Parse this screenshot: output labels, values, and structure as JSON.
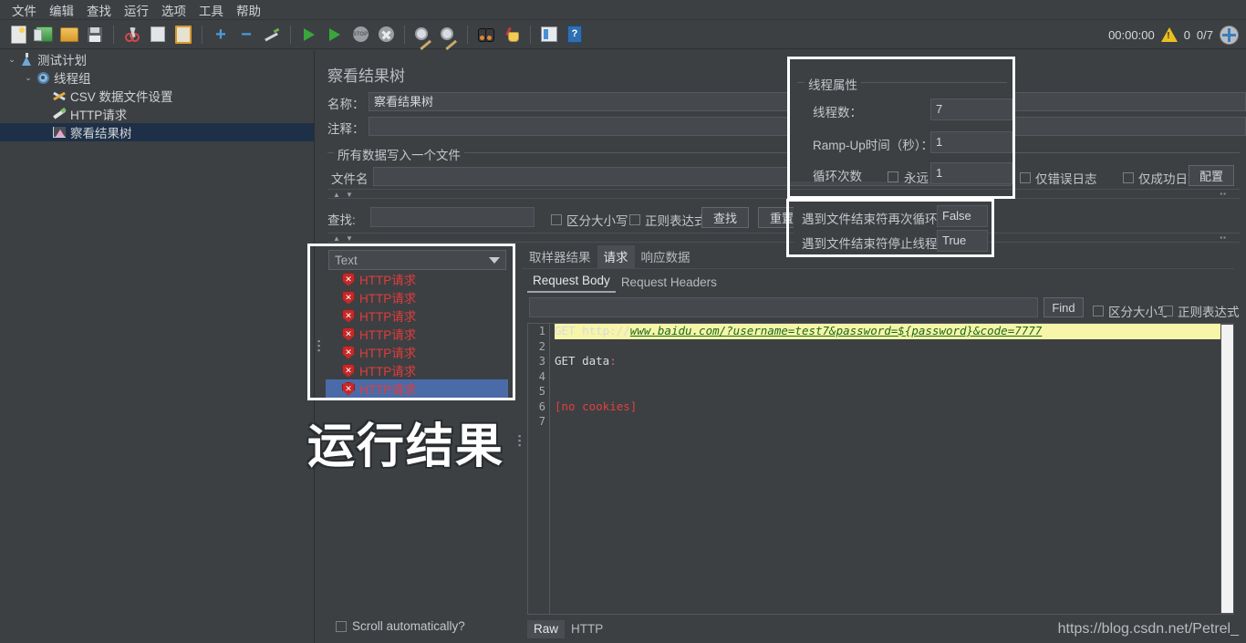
{
  "menu": {
    "items": [
      "文件",
      "编辑",
      "查找",
      "运行",
      "选项",
      "工具",
      "帮助"
    ]
  },
  "toolbar": {
    "icons": [
      "new-icon",
      "template-icon",
      "open-icon",
      "save-icon",
      "cut-icon",
      "copy-icon",
      "paste-icon",
      "expand-icon",
      "collapse-icon",
      "toggle-icon",
      "start-icon",
      "start-no-pause-icon",
      "stop-icon",
      "shutdown-icon",
      "clear-icon",
      "clear-all-icon",
      "search-icon",
      "search-reset-icon",
      "function-helper-icon",
      "help-icon"
    ],
    "status": {
      "clock": "00:00:00",
      "warnings": "0",
      "threads": "0/7"
    }
  },
  "tree": {
    "items": [
      {
        "label": "测试计划",
        "icon": "test-plan-icon",
        "indent": 0,
        "expanded": true,
        "selected": false
      },
      {
        "label": "线程组",
        "icon": "thread-group-icon",
        "indent": 1,
        "expanded": true,
        "selected": false
      },
      {
        "label": "CSV 数据文件设置",
        "icon": "csv-config-icon",
        "indent": 2,
        "expanded": null,
        "selected": false
      },
      {
        "label": "HTTP请求",
        "icon": "http-sampler-icon",
        "indent": 2,
        "expanded": null,
        "selected": false
      },
      {
        "label": "察看结果树",
        "icon": "view-results-tree-icon",
        "indent": 2,
        "expanded": null,
        "selected": true
      }
    ]
  },
  "panel": {
    "title": "察看结果树",
    "name_label": "名称：",
    "name_value": "察看结果树",
    "comment_label": "注释：",
    "comment_value": "",
    "group_title": "所有数据写入一个文件",
    "filename_label": "文件名",
    "filename_value": "",
    "errors_only_label": "仅错误日志",
    "success_only_label": "仅成功日志",
    "configure_button": "配置"
  },
  "search_bar": {
    "label": "查找:",
    "value": "",
    "case_label": "区分大小写",
    "regex_label": "正则表达式",
    "find_button": "查找",
    "reset_button": "重置"
  },
  "results": {
    "render_selected": "Text",
    "entries": [
      {
        "label": "HTTP请求",
        "status": "error",
        "selected": false
      },
      {
        "label": "HTTP请求",
        "status": "error",
        "selected": false
      },
      {
        "label": "HTTP请求",
        "status": "error",
        "selected": false
      },
      {
        "label": "HTTP请求",
        "status": "error",
        "selected": false
      },
      {
        "label": "HTTP请求",
        "status": "error",
        "selected": false
      },
      {
        "label": "HTTP请求",
        "status": "error",
        "selected": false
      },
      {
        "label": "HTTP请求",
        "status": "error",
        "selected": true
      }
    ],
    "scroll_auto_label": "Scroll automatically?"
  },
  "detail": {
    "tabs": [
      {
        "label": "取样器结果",
        "active": false
      },
      {
        "label": "请求",
        "active": true
      },
      {
        "label": "响应数据",
        "active": false
      }
    ],
    "subtabs": [
      {
        "label": "Request Body",
        "active": true
      },
      {
        "label": "Request Headers",
        "active": false
      }
    ],
    "find_value": "",
    "find_button": "Find",
    "case_label": "区分大小写",
    "regex_label": "正则表达式",
    "code_lines": [
      {
        "n": "1",
        "text": "GET http://www.baidu.com/?username=test7&password=${password}&code=7777",
        "style": "highlight"
      },
      {
        "n": "2",
        "text": "",
        "style": "plain"
      },
      {
        "n": "3",
        "text": "GET data:",
        "style": "plain"
      },
      {
        "n": "4",
        "text": "",
        "style": "plain"
      },
      {
        "n": "5",
        "text": "",
        "style": "plain"
      },
      {
        "n": "6",
        "text": "[no cookies]",
        "style": "red"
      },
      {
        "n": "7",
        "text": "",
        "style": "plain"
      }
    ],
    "bottom_tabs": [
      {
        "label": "Raw",
        "active": true
      },
      {
        "label": "HTTP",
        "active": false
      }
    ]
  },
  "thread_props": {
    "title": "线程属性",
    "rows": [
      {
        "label": "线程数：",
        "value": "7"
      },
      {
        "label": "Ramp-Up时间（秒）：",
        "value": "1"
      }
    ],
    "loop_label": "循环次数",
    "forever_label": "永远",
    "loop_value": "1"
  },
  "csv_props": {
    "rows": [
      {
        "label": "遇到文件结束符再次循环？：",
        "value": "False"
      },
      {
        "label": "遇到文件结束符停止线程？：",
        "value": "True"
      }
    ]
  },
  "annotations": {
    "big_label": "运行结果",
    "watermark": "https://blog.csdn.net/Petrel_"
  },
  "colors": {
    "background": "#3c4043",
    "selection": "#4a6ba8",
    "tree_selection": "#1d3048",
    "error_text": "#e23b3b",
    "highlight_bg": "#f6f5a8",
    "highlight_text": "#1d6a1d",
    "annotation": "#ffffff"
  }
}
